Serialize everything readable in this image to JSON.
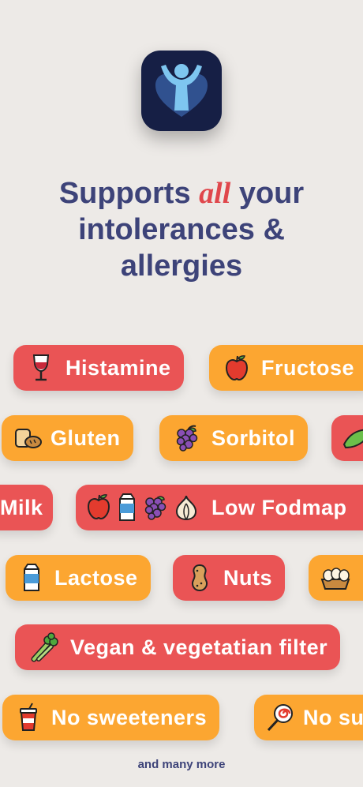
{
  "headline": {
    "line1_before": "Supports ",
    "line1_accent": "all",
    "line1_after": " your",
    "line2": "intolerances &",
    "line3": "allergies"
  },
  "chips": {
    "histamine": "Histamine",
    "fructose": "Fructose",
    "gluten": "Gluten",
    "sorbitol": "Sorbitol",
    "milk": "Milk",
    "low_fodmap": "Low Fodmap",
    "lactose": "Lactose",
    "nuts": "Nuts",
    "vegan": "Vegan & vegetatian filter",
    "no_sweeteners": "No sweeteners",
    "no_sugar": "No su"
  },
  "colors": {
    "red_chip": "#ea5455",
    "orange_chip": "#fca631",
    "headline": "#3d4379",
    "accent": "#e0474c"
  },
  "footer": {
    "text": "and many more"
  }
}
